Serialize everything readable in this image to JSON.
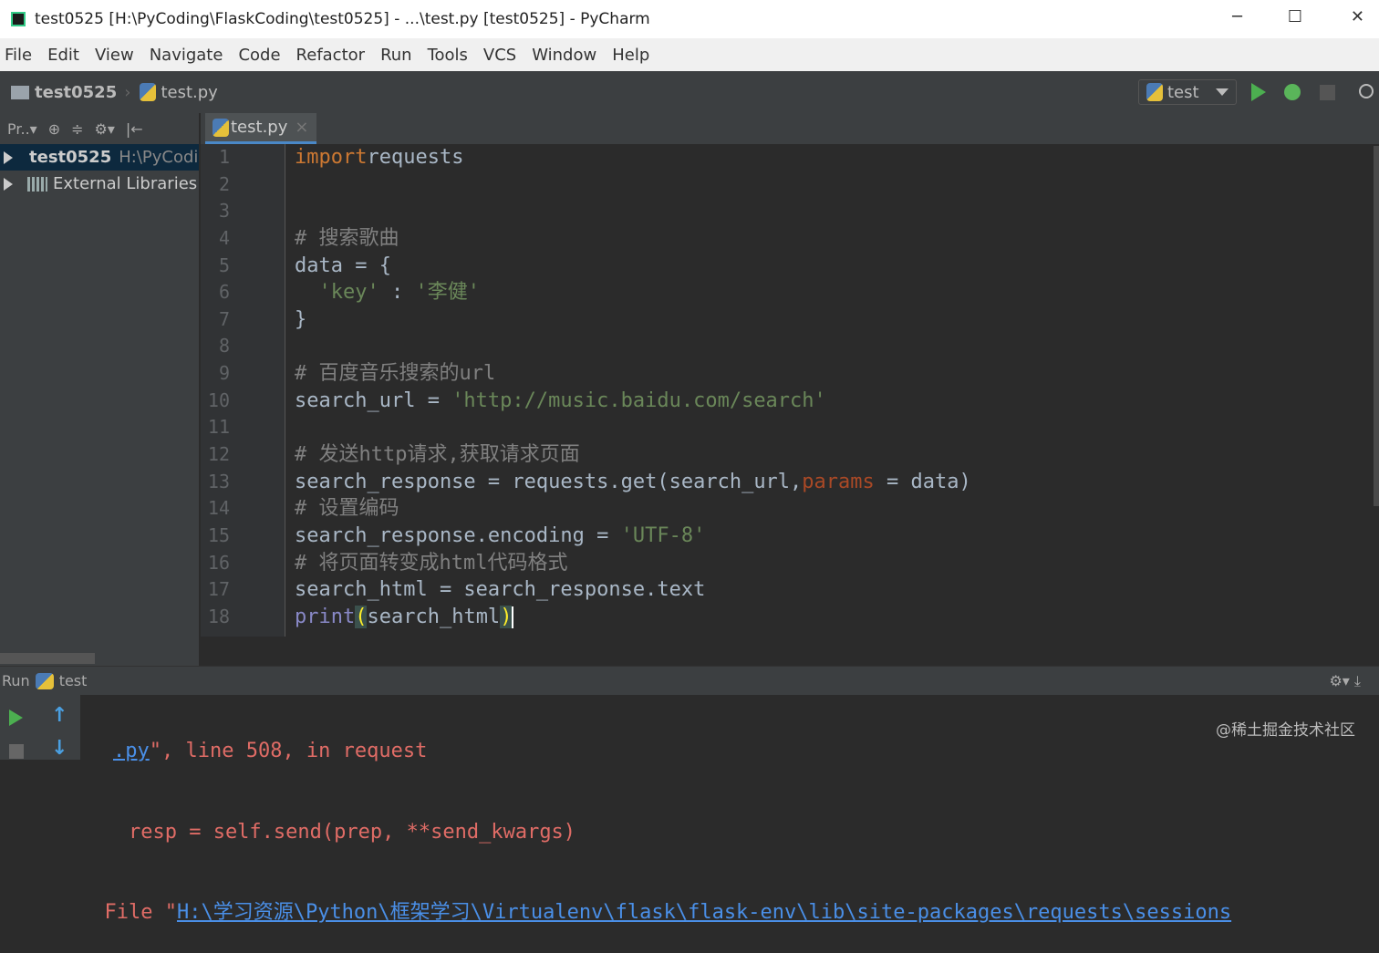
{
  "window": {
    "title": "test0525 [H:\\PyCoding\\FlaskCoding\\test0525] - ...\\test.py [test0525] - PyCharm",
    "minimize": "─",
    "maximize": "☐",
    "close": "✕"
  },
  "menu": [
    "File",
    "Edit",
    "View",
    "Navigate",
    "Code",
    "Refactor",
    "Run",
    "Tools",
    "VCS",
    "Window",
    "Help"
  ],
  "breadcrumb": {
    "project": "test0525",
    "file": "test.py"
  },
  "run_config": {
    "name": "test"
  },
  "sidebar": {
    "dropdown": "Pr..▾",
    "items": [
      {
        "label": "test0525",
        "path": "H:\\PyCoding"
      },
      {
        "label": "External Libraries"
      }
    ]
  },
  "editor": {
    "tab": "test.py",
    "tab_close": "×",
    "lines": [
      [
        [
          "kw",
          "import"
        ],
        [
          "",
          "requests"
        ]
      ],
      [],
      [],
      [
        [
          "cm",
          "# 搜索歌曲"
        ]
      ],
      [
        [
          "",
          "data = {"
        ]
      ],
      [
        [
          "",
          "  "
        ],
        [
          "str",
          "'key'"
        ],
        [
          "",
          " : "
        ],
        [
          "str",
          "'李健'"
        ]
      ],
      [
        [
          "",
          "}"
        ]
      ],
      [],
      [
        [
          "cm",
          "# 百度音乐搜索的url"
        ]
      ],
      [
        [
          "",
          "search_url = "
        ],
        [
          "str",
          "'http://music.baidu.com/search'"
        ]
      ],
      [],
      [
        [
          "cm",
          "# 发送http请求,获取请求页面"
        ]
      ],
      [
        [
          "",
          "search_response = requests.get(search_url,"
        ],
        [
          "par",
          "params"
        ],
        [
          "",
          " = data)"
        ]
      ],
      [
        [
          "cm",
          "# 设置编码"
        ]
      ],
      [
        [
          "",
          "search_response.encoding = "
        ],
        [
          "str",
          "'UTF-8'"
        ]
      ],
      [
        [
          "cm",
          "# 将页面转变成html代码格式"
        ]
      ],
      [
        [
          "",
          "search_html = search_response.text"
        ]
      ],
      [
        [
          "bi",
          "print"
        ],
        [
          "br",
          "("
        ],
        [
          "",
          "search_html"
        ],
        [
          "br",
          ")"
        ]
      ]
    ]
  },
  "run": {
    "label": "Run",
    "config": "test",
    "output": [
      {
        "link": ".py",
        "text": "\", line 508, in request"
      },
      {
        "text": "    resp = self.send(prep, **send_kwargs)"
      },
      {
        "prefix": "  File \"",
        "link": "H:\\学习资源\\Python\\框架学习\\Virtualenv\\flask\\flask-env\\lib\\site-packages\\requests\\sessions"
      }
    ]
  },
  "watermark": "@稀土掘金技术社区"
}
